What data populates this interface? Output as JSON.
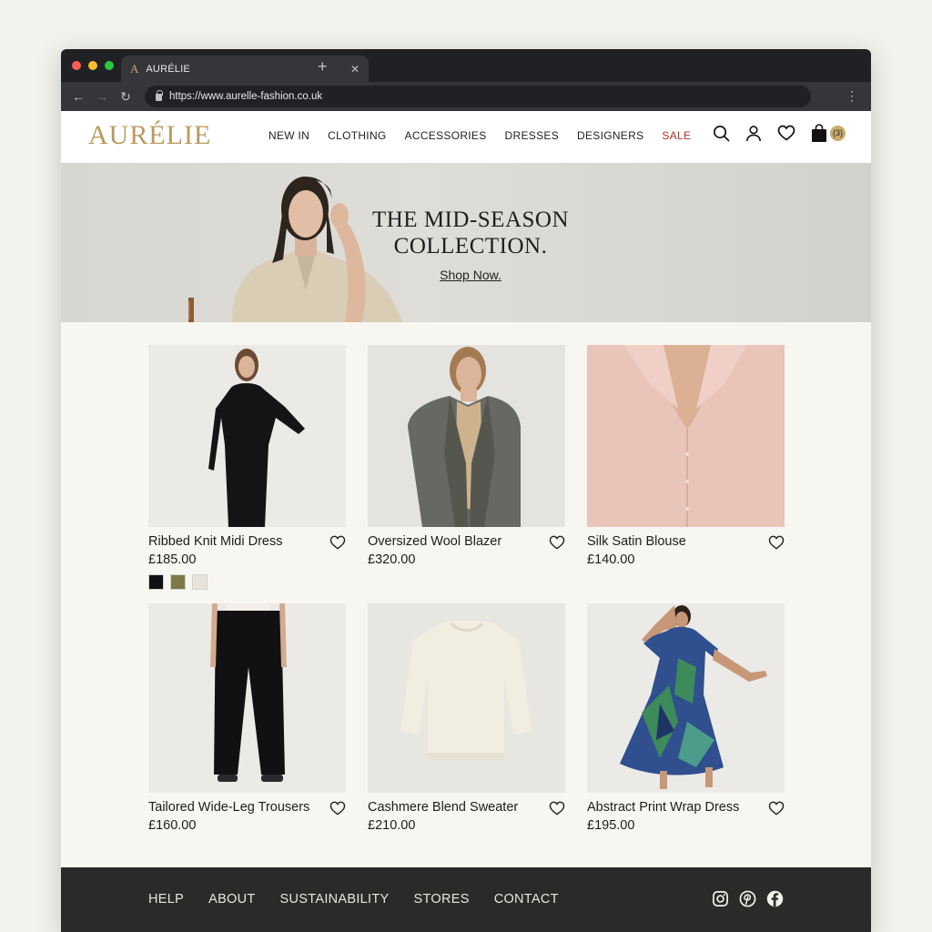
{
  "browser": {
    "tab_title": "AURÉLIE",
    "tab_favicon": "A",
    "url": "https://www.aurelle-fashion.co.uk"
  },
  "site": {
    "logo": "AURÉLIE",
    "nav": [
      "NEW IN",
      "CLOTHING",
      "ACCESSORIES",
      "DRESSES",
      "DESIGNERS",
      "SALE"
    ],
    "cart_count": "(3)",
    "icons": [
      "search-icon",
      "account-icon",
      "wishlist-heart-icon",
      "shopping-bag-icon"
    ]
  },
  "hero": {
    "title_line1": "THE MID-SEASON",
    "title_line2": "COLLECTION.",
    "cta": "Shop Now."
  },
  "products": [
    {
      "name": "Ribbed Knit Midi Dress",
      "price": "£185.00",
      "swatches": [
        "#111111",
        "#7d7a4a",
        "#e8e4da"
      ]
    },
    {
      "name": "Oversized Wool Blazer",
      "price": "£320.00"
    },
    {
      "name": "Silk Satin Blouse",
      "price": "£140.00"
    },
    {
      "name": "Tailored Wide-Leg Trousers",
      "price": "£160.00"
    },
    {
      "name": "Cashmere Blend Sweater",
      "price": "£210.00"
    },
    {
      "name": "Abstract Print Wrap Dress",
      "price": "£195.00"
    }
  ],
  "footer": {
    "links": [
      "HELP",
      "ABOUT",
      "SUSTAINABILITY",
      "STORES",
      "CONTACT"
    ],
    "social": [
      "instagram-icon",
      "pinterest-icon",
      "facebook-icon"
    ]
  },
  "colors": {
    "brand_gold": "#b99a5f",
    "sale_red": "#b0322a",
    "footer_bg": "#2b2a28"
  }
}
